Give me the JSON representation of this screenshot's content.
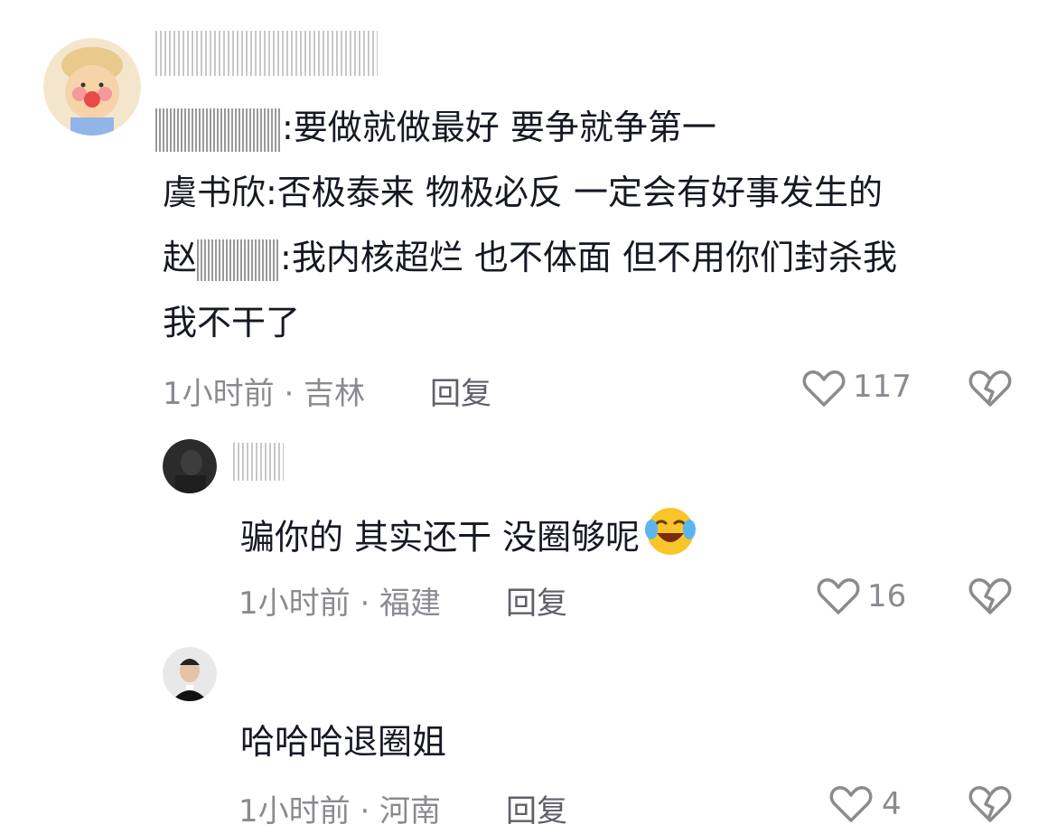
{
  "comment": {
    "prefix_line1": ":要做就做最好 要争就争第一",
    "line2": "虞书欣:否极泰来 物极必反 一定会有好事发生的",
    "line3_prefix": "赵",
    "line3_rest": ":我内核超烂 也不体面 但不用你们封杀我",
    "line4": "我不干了",
    "time_location": "1小时前 · 吉林",
    "reply_label": "回复",
    "likes": "117"
  },
  "replies": [
    {
      "text": "骗你的 其实还干 没圈够呢",
      "emoji": "laughing-crying-emoji",
      "time_location": "1小时前 · 福建",
      "reply_label": "回复",
      "likes": "16"
    },
    {
      "text": "哈哈哈退圈姐",
      "time_location": "1小时前 · 河南",
      "reply_label": "回复",
      "likes": "4"
    }
  ],
  "icons": {
    "like": "heart-icon",
    "dislike": "broken-heart-icon"
  },
  "colors": {
    "text": "#161823",
    "meta": "#8a8b91",
    "reply": "#5f6068"
  }
}
